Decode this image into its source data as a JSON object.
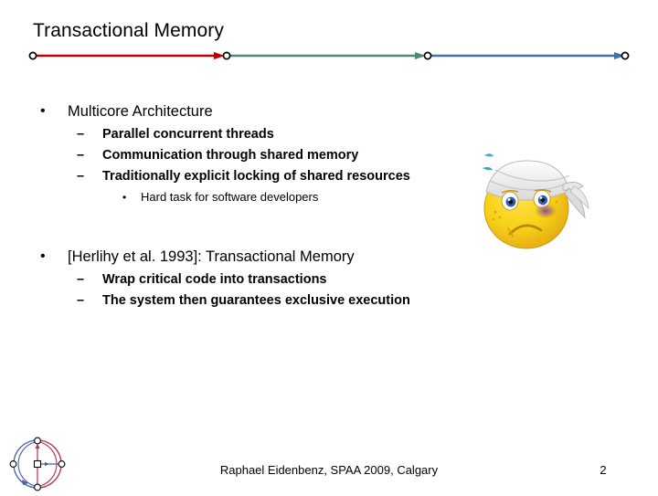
{
  "slide": {
    "title": "Transactional Memory",
    "page_number": "2",
    "footer": "Raphael Eidenbenz,  SPAA 2009, Calgary"
  },
  "rule": {
    "segment1_color": "#C00000",
    "segment2_color": "#4E8A6E",
    "segment3_color": "#4472A8",
    "node_color": "#000000"
  },
  "content": {
    "bullet_marker": "•",
    "dash_marker": "–",
    "groups": [
      {
        "heading": "Multicore Architecture",
        "subitems": [
          "Parallel concurrent threads",
          "Communication through shared memory",
          "Traditionally explicit locking of shared resources"
        ],
        "subsub": [
          "Hard task for software developers"
        ]
      },
      {
        "heading": "[Herlihy et al. 1993]: Transactional Memory",
        "subitems": [
          "Wrap critical code into transactions",
          "The system then guarantees exclusive execution"
        ],
        "subsub": []
      }
    ]
  },
  "emoji": {
    "name": "injured-bandaged-smiley",
    "face_color": "#F7D117",
    "face_shadow": "#E0A81C",
    "bandage_color": "#F2F2F2",
    "bruise_color": "#9B5FA0",
    "eye_color": "#2B5FA8",
    "sweat_color": "#3BA8C4"
  },
  "logo": {
    "name": "eth-disco-circle-logo",
    "arc_red": "#B03048",
    "arc_blue": "#4A5FA0",
    "node_fill": "#FFFFFF"
  }
}
